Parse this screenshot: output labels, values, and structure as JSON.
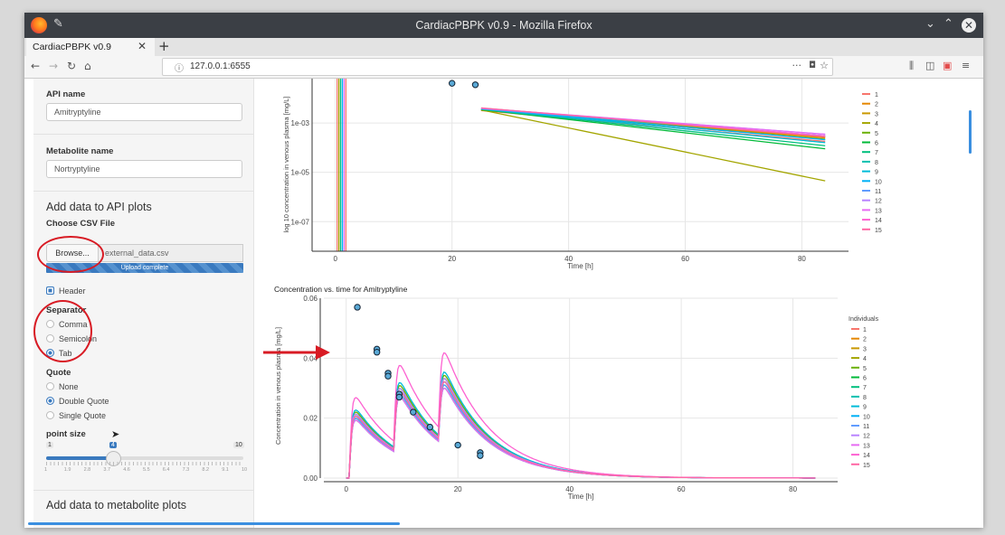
{
  "window": {
    "title": "CardiacPBPK v0.9 - Mozilla Firefox",
    "tab_label": "CardiacPBPK v0.9",
    "new_tab": "+",
    "url": "127.0.0.1:6555",
    "url_more": "···"
  },
  "sidebar": {
    "api_name_label": "API name",
    "api_name_value": "Amitryptyline",
    "metabolite_label": "Metabolite name",
    "metabolite_value": "Nortryptyline",
    "add_api_heading": "Add data to API plots",
    "csv_label": "Choose CSV File",
    "browse_label": "Browse...",
    "file_name": "external_data.csv",
    "upload_status": "Upload complete",
    "header_label": "Header",
    "separator_label": "Separator",
    "separator_options": [
      "Comma",
      "Semicolon",
      "Tab"
    ],
    "separator_selected": "Tab",
    "quote_label": "Quote",
    "quote_options": [
      "None",
      "Double Quote",
      "Single Quote"
    ],
    "quote_selected": "Double Quote",
    "point_size_label": "point size",
    "slider_min": "1",
    "slider_max": "10",
    "slider_value": "4",
    "slider_ticks": [
      "1",
      "1.9",
      "2.8",
      "3.7",
      "4.6",
      "5.5",
      "6.4",
      "7.3",
      "8.2",
      "9.1",
      "10"
    ],
    "add_metabolite_heading": "Add data to metabolite plots"
  },
  "colors": {
    "accent": "#3a7abf",
    "annotation_red": "#d81b24",
    "series": [
      "#f8766d",
      "#e58700",
      "#c99800",
      "#a3a500",
      "#6bb100",
      "#00ba38",
      "#00bf7d",
      "#00c0af",
      "#00bcd8",
      "#00b0f6",
      "#619cff",
      "#b983ff",
      "#e76bf3",
      "#fd61d1",
      "#ff67a4"
    ]
  },
  "icons": [
    "firefox-icon",
    "pin-icon",
    "minimize-icon",
    "maximize-icon",
    "close-icon",
    "back-icon",
    "forward-icon",
    "reload-icon",
    "home-icon",
    "info-icon",
    "pocket-icon",
    "bookmark-star-icon",
    "library-icon",
    "sidebar-toggle-icon",
    "extension-icon",
    "menu-icon"
  ],
  "chart_data": [
    {
      "type": "line",
      "title": "",
      "xlabel": "Time [h]",
      "ylabel": "log 10 concentration in venous plasma [mg/L]",
      "x_ticks": [
        "0",
        "20",
        "40",
        "60",
        "80"
      ],
      "y_ticks": [
        "1e-03",
        "1e-05",
        "1e-07"
      ],
      "xlim": [
        -4,
        88
      ],
      "y_scale": "log",
      "legend_items": [
        "1",
        "2",
        "3",
        "4",
        "5",
        "6",
        "7",
        "8",
        "9",
        "10",
        "11",
        "12",
        "13",
        "14",
        "15"
      ],
      "legend_placement": "right",
      "series_end_values": [
        0.00018,
        0.00025,
        0.00027,
        4.5e-06,
        0.00022,
        9e-05,
        0.00012,
        0.0003,
        0.00016,
        0.00021,
        0.0003,
        0.00035,
        0.00035,
        0.0003,
        0.00028
      ],
      "points": [
        {
          "x": 20,
          "y": 0.08
        },
        {
          "x": 24,
          "y": 0.07
        }
      ]
    },
    {
      "type": "line",
      "title": "Concentration vs. time for Amitryptyline",
      "xlabel": "Time [h]",
      "ylabel": "Concentration in venous plasma [mg/L]",
      "x_ticks": [
        "0",
        "20",
        "40",
        "60",
        "80"
      ],
      "y_ticks": [
        "0.00",
        "0.02",
        "0.04",
        "0.06"
      ],
      "xlim": [
        -4,
        88
      ],
      "ylim": [
        0,
        0.06
      ],
      "legend_title": "Individuals",
      "legend_items": [
        "1",
        "2",
        "3",
        "4",
        "5",
        "6",
        "7",
        "8",
        "9",
        "10",
        "11",
        "12",
        "13",
        "14",
        "15"
      ],
      "legend_placement": "right",
      "doses_at": [
        0,
        8,
        16
      ],
      "peaks": [
        0.03,
        0.031,
        0.029,
        0.03,
        0.032,
        0.031,
        0.028,
        0.029,
        0.033,
        0.03,
        0.029,
        0.031,
        0.028,
        0.039,
        0.03
      ],
      "points": [
        {
          "x": 2,
          "y": 0.057
        },
        {
          "x": 5.5,
          "y": 0.043
        },
        {
          "x": 5.5,
          "y": 0.042
        },
        {
          "x": 7.5,
          "y": 0.035
        },
        {
          "x": 7.5,
          "y": 0.034
        },
        {
          "x": 9.5,
          "y": 0.028
        },
        {
          "x": 9.5,
          "y": 0.027
        },
        {
          "x": 12,
          "y": 0.022
        },
        {
          "x": 15,
          "y": 0.017
        },
        {
          "x": 20,
          "y": 0.011
        },
        {
          "x": 24,
          "y": 0.0085
        },
        {
          "x": 24,
          "y": 0.0075
        }
      ]
    }
  ]
}
